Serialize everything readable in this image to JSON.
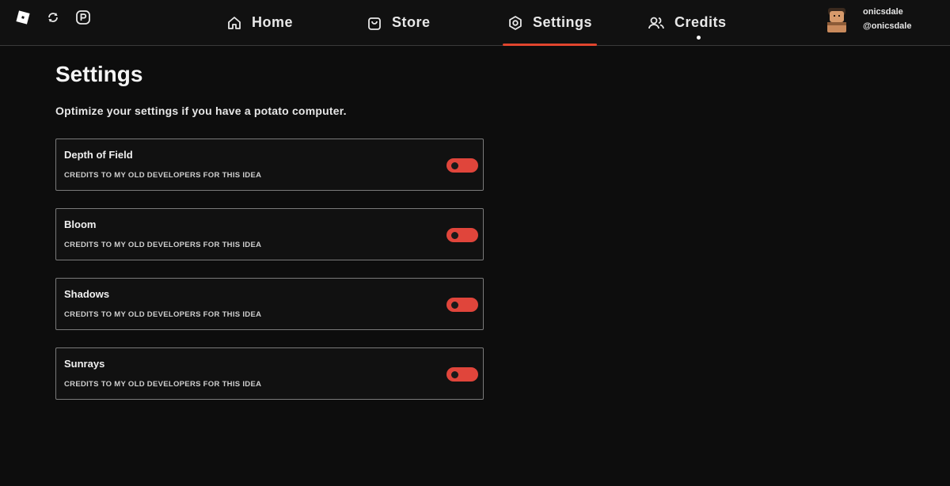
{
  "nav": {
    "home_label": "Home",
    "store_label": "Store",
    "settings_label": "Settings",
    "credits_label": "Credits",
    "active": "Settings"
  },
  "left_icons": [
    "roblox-logo-icon",
    "refresh-icon",
    "robux-icon"
  ],
  "user": {
    "display_name": "onicsdale",
    "username": "@onicsdale"
  },
  "page": {
    "title": "Settings",
    "subtitle": "Optimize your settings if you have a potato computer."
  },
  "settings": [
    {
      "title": "Depth of Field",
      "description": "CREDITS TO MY OLD DEVELOPERS FOR THIS IDEA",
      "enabled": true
    },
    {
      "title": "Bloom",
      "description": "CREDITS TO MY OLD DEVELOPERS FOR THIS IDEA",
      "enabled": true
    },
    {
      "title": "Shadows",
      "description": "CREDITS TO MY OLD DEVELOPERS FOR THIS IDEA",
      "enabled": true
    },
    {
      "title": "Sunrays",
      "description": "CREDITS TO MY OLD DEVELOPERS FOR THIS IDEA",
      "enabled": true
    }
  ],
  "colors": {
    "accent": "#e0452e",
    "toggle_on": "#e0453b",
    "background": "#0d0d0d",
    "card_border": "#7a7a7a"
  }
}
